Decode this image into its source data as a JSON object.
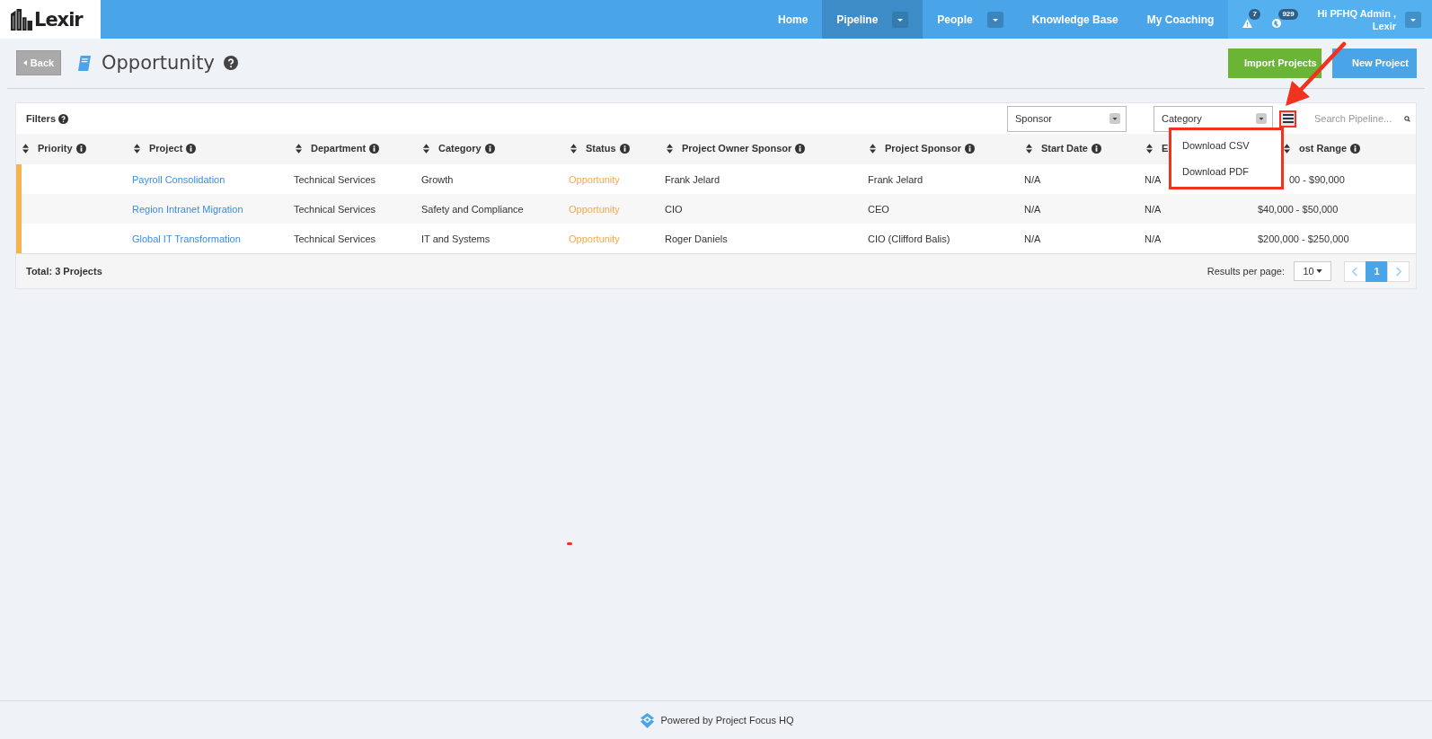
{
  "nav": {
    "logo_text": "Lexir",
    "items": [
      {
        "label": "Home",
        "selected": false,
        "dropdown": false
      },
      {
        "label": "Pipeline",
        "selected": true,
        "dropdown": true
      },
      {
        "label": "People",
        "selected": false,
        "dropdown": true
      },
      {
        "label": "Knowledge Base",
        "selected": false,
        "dropdown": false
      },
      {
        "label": "My Coaching",
        "selected": false,
        "dropdown": false
      }
    ],
    "alerts": [
      {
        "kind": "warning",
        "count": "7"
      },
      {
        "kind": "globe",
        "count": "929"
      }
    ],
    "user": {
      "greeting": "Hi PFHQ Admin ,",
      "org": "Lexir"
    }
  },
  "header": {
    "back": "Back",
    "title": "Opportunity",
    "buttons": [
      {
        "label": "Import Projects",
        "kind": "import"
      },
      {
        "label": "New Project",
        "kind": "new"
      }
    ]
  },
  "filters": {
    "label": "Filters",
    "selects": [
      {
        "value": "Sponsor"
      },
      {
        "value": "Category"
      }
    ],
    "search": {
      "placeholder": "Search Pipeline..."
    }
  },
  "export_menu": {
    "expanded": true,
    "items": [
      "Download CSV",
      "Download PDF"
    ]
  },
  "table": {
    "columns": [
      {
        "label": "Priority"
      },
      {
        "label": "Project"
      },
      {
        "label": "Department"
      },
      {
        "label": "Category"
      },
      {
        "label": "Status"
      },
      {
        "label": "Project Owner Sponsor"
      },
      {
        "label": "Project Sponsor"
      },
      {
        "label": "Start Date"
      },
      {
        "label": "E"
      },
      {
        "label": "ost Range"
      }
    ],
    "rows": [
      {
        "color": "#f4b350",
        "cells": [
          "",
          "Payroll Consolidation",
          "Technical Services",
          "Growth",
          "Opportunity",
          "Frank Jelard",
          "Frank Jelard",
          "N/A",
          "N/A",
          "00 - $90,000"
        ]
      },
      {
        "color": "#f4b350",
        "cells": [
          "",
          "Region Intranet Migration",
          "Technical Services",
          "Safety and Compliance",
          "Opportunity",
          "CIO",
          "CEO",
          "N/A",
          "N/A",
          "$40,000 - $50,000"
        ]
      },
      {
        "color": "#f4b350",
        "cells": [
          "",
          "Global IT Transformation",
          "Technical Services",
          "IT and Systems",
          "Opportunity",
          "Roger Daniels",
          "CIO (Clifford Balis)",
          "N/A",
          "N/A",
          "$200,000 - $250,000"
        ]
      }
    ]
  },
  "footer": {
    "total": "Total: 3 Projects",
    "per_page_label": "Results per page:",
    "per_page": "10",
    "pages": [
      {
        "label": "1",
        "selected": true
      }
    ]
  },
  "powered_by": "Powered by Project Focus HQ"
}
